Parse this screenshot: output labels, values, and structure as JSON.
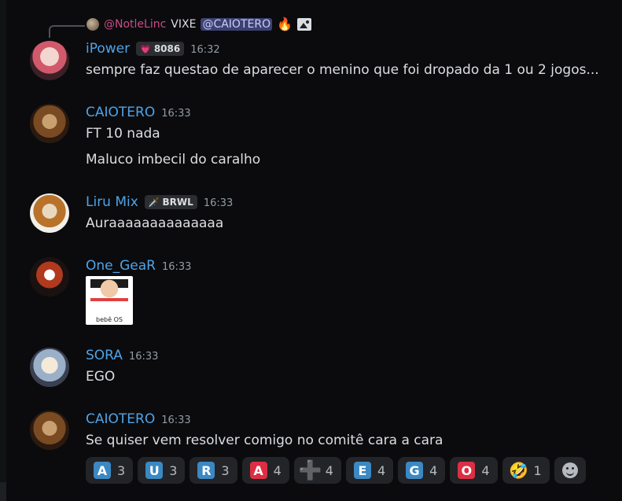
{
  "reply": {
    "author": "@NotleLinc",
    "text": "VIXE",
    "mention": "@CAIOTERO",
    "emoji": "🔥",
    "attachment_icon": "image-icon"
  },
  "messages": [
    {
      "author": "iPower",
      "tag": {
        "icon": "💗",
        "text": "8086"
      },
      "time": "16:32",
      "lines": [
        "sempre faz questao de aparecer o menino que foi dropado da 1 ou 2 jogos..."
      ]
    },
    {
      "author": "CAIOTERO",
      "time": "16:33",
      "lines": [
        "FT 10 nada",
        "Maluco imbecil do caralho"
      ]
    },
    {
      "author": "Liru Mix",
      "tag": {
        "icon": "🗡️",
        "text": "BRWL"
      },
      "time": "16:33",
      "lines": [
        "Auraaaaaaaaaaaaaa"
      ]
    },
    {
      "author": "One_GeaR",
      "time": "16:33",
      "sticker_caption": "bebê OS"
    },
    {
      "author": "SORA",
      "time": "16:33",
      "lines": [
        "EGO"
      ]
    },
    {
      "author": "CAIOTERO",
      "time": "16:33",
      "lines": [
        "Se quiser vem resolver comigo no comitê cara a cara"
      ]
    }
  ],
  "reactions": [
    {
      "glyph": "A",
      "count": "3",
      "color": "#3b88c3"
    },
    {
      "glyph": "U",
      "count": "3",
      "color": "#3b88c3"
    },
    {
      "glyph": "R",
      "count": "3",
      "color": "#3b88c3"
    },
    {
      "glyph": "A",
      "count": "4",
      "color": "#dd2e44"
    },
    {
      "glyph": "➕",
      "count": "4",
      "color": "#9aa0a6"
    },
    {
      "glyph": "E",
      "count": "4",
      "color": "#3b88c3"
    },
    {
      "glyph": "G",
      "count": "4",
      "color": "#3b88c3"
    },
    {
      "glyph": "O",
      "count": "4",
      "color": "#dd2e44"
    },
    {
      "glyph": "🤣",
      "count": "1",
      "color": ""
    }
  ],
  "add_reaction_icon": "smile-icon"
}
